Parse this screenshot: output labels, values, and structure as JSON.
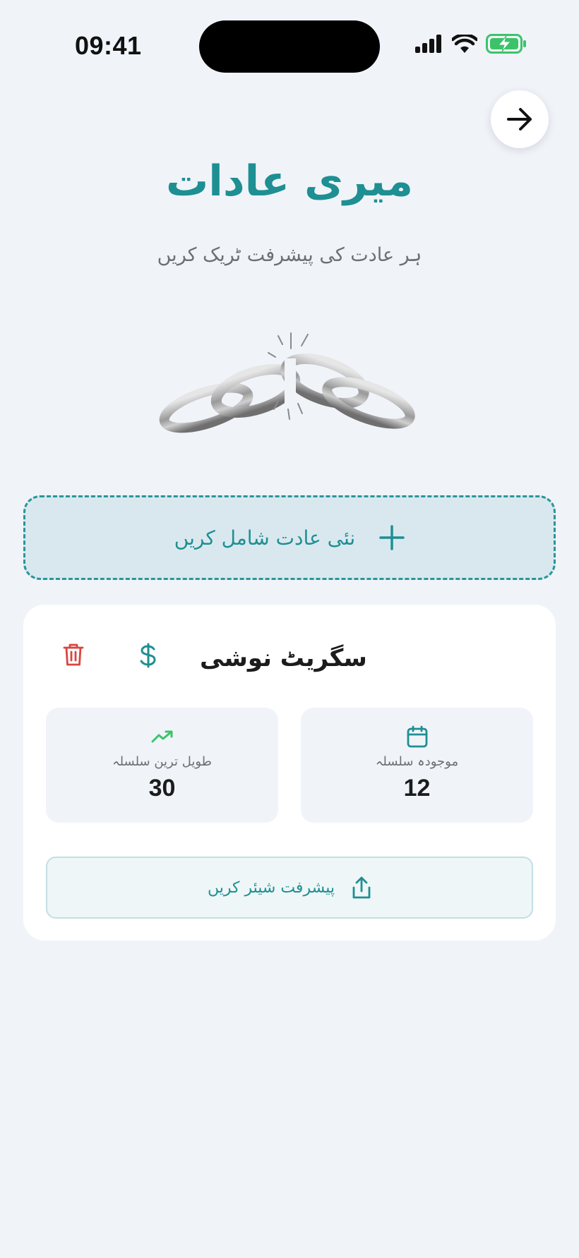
{
  "status_bar": {
    "time": "09:41"
  },
  "header": {
    "title": "میری عادات",
    "subtitle": "ہر عادت کی پیشرفت ٹریک کریں"
  },
  "add_habit": {
    "label": "نئی عادت شامل کریں"
  },
  "habit": {
    "name": "سگریٹ نوشی",
    "current_streak_label": "موجودہ سلسلہ",
    "current_streak_value": "12",
    "longest_streak_label": "طویل ترین سلسلہ",
    "longest_streak_value": "30",
    "share_label": "پیشرفت شیئر کریں"
  },
  "colors": {
    "accent": "#1e8f92",
    "background": "#f0f4f9",
    "delete": "#d9453f",
    "trend": "#3cc36a",
    "battery": "#3cc36a"
  },
  "icons": [
    "signal-icon",
    "wifi-icon",
    "battery-icon",
    "arrow-right-icon",
    "broken-chain-icon",
    "plus-icon",
    "dollar-icon",
    "trash-icon",
    "calendar-icon",
    "trending-up-icon",
    "share-icon"
  ]
}
